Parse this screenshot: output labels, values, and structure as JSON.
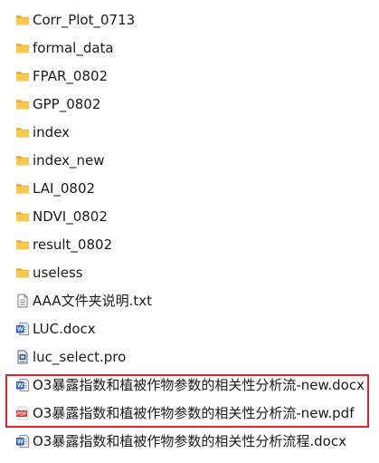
{
  "files": [
    {
      "name": "Corr_Plot_0713",
      "type": "folder",
      "icon": "folder-icon"
    },
    {
      "name": "formal_data",
      "type": "folder",
      "icon": "folder-icon"
    },
    {
      "name": "FPAR_0802",
      "type": "folder",
      "icon": "folder-icon"
    },
    {
      "name": "GPP_0802",
      "type": "folder",
      "icon": "folder-icon"
    },
    {
      "name": "index",
      "type": "folder",
      "icon": "folder-icon"
    },
    {
      "name": "index_new",
      "type": "folder",
      "icon": "folder-icon"
    },
    {
      "name": "LAI_0802",
      "type": "folder",
      "icon": "folder-icon"
    },
    {
      "name": "NDVI_0802",
      "type": "folder",
      "icon": "folder-icon"
    },
    {
      "name": "result_0802",
      "type": "folder",
      "icon": "folder-icon"
    },
    {
      "name": "useless",
      "type": "folder",
      "icon": "folder-icon"
    },
    {
      "name": "AAA文件夹说明.txt",
      "type": "txt",
      "icon": "text-file-icon"
    },
    {
      "name": "LUC.docx",
      "type": "docx",
      "icon": "word-document-icon"
    },
    {
      "name": "luc_select.pro",
      "type": "pro",
      "icon": "project-file-icon"
    },
    {
      "name": "O3暴露指数和植被作物参数的相关性分析流-new.docx",
      "type": "docx",
      "icon": "word-document-icon"
    },
    {
      "name": "O3暴露指数和植被作物参数的相关性分析流-new.pdf",
      "type": "pdf",
      "icon": "pdf-document-icon"
    },
    {
      "name": "O3暴露指数和植被作物参数的相关性分析流程.docx",
      "type": "docx",
      "icon": "word-document-icon"
    }
  ],
  "colors": {
    "highlight": "#e0202a",
    "folder": "#f6c443",
    "word": "#2b5fb4",
    "pdf": "#d9362b"
  }
}
